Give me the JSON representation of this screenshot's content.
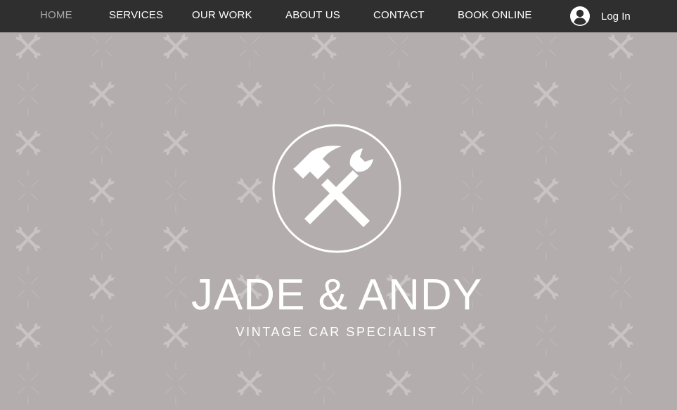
{
  "nav": {
    "items": [
      {
        "label": "HOME",
        "active": true
      },
      {
        "label": "SERVICES",
        "active": false
      },
      {
        "label": "OUR WORK",
        "active": false
      },
      {
        "label": "ABOUT US",
        "active": false
      },
      {
        "label": "CONTACT",
        "active": false
      },
      {
        "label": "BOOK ONLINE",
        "active": false
      }
    ],
    "login_label": "Log In",
    "login_icon": "user-avatar-icon"
  },
  "hero": {
    "title": "JADE & ANDY",
    "subtitle": "VINTAGE CAR SPECIALIST",
    "logo_icon": "hammer-and-wrench-icon",
    "pattern_icon": "crossed-wrenches-icon"
  },
  "colors": {
    "nav_background": "#2f2f2f",
    "nav_text": "#ffffff",
    "nav_active_text": "#a9a9a9",
    "hero_background": "#b3adad",
    "hero_text": "#ffffff"
  }
}
